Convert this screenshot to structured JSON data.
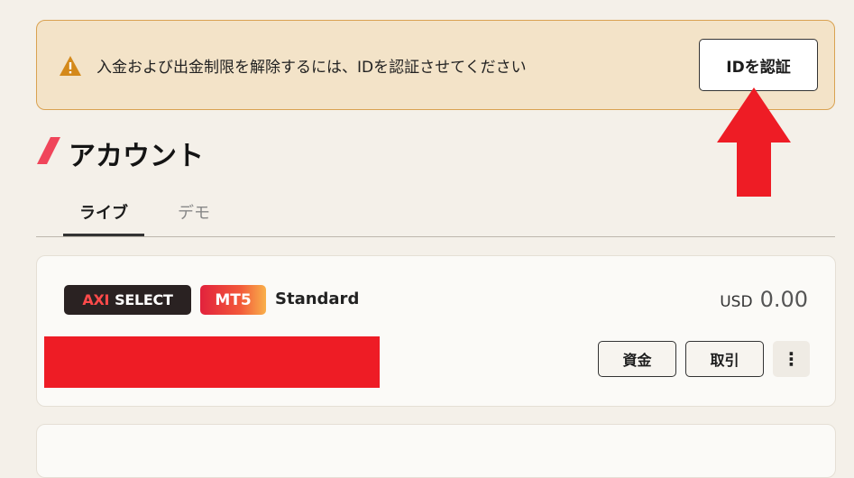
{
  "banner": {
    "message": "入金および出金制限を解除するには、IDを認証させてください",
    "button_label": "IDを認証",
    "icon": "warning-icon"
  },
  "section": {
    "title": "アカウント"
  },
  "tabs": [
    {
      "label": "ライブ",
      "active": true
    },
    {
      "label": "デモ",
      "active": false
    }
  ],
  "account_card": {
    "brand_badge_prefix": "AXI",
    "brand_badge_suffix": "SELECT",
    "platform_badge": "MT5",
    "account_type": "Standard",
    "currency": "USD",
    "balance": "0.00",
    "fund_button": "資金",
    "trade_button": "取引",
    "more_icon": "⋮"
  },
  "colors": {
    "banner_bg": "#f3e3c8",
    "banner_border": "#d9a251",
    "arrow": "#ee1c25",
    "redaction": "#ee1c25",
    "accent": "#e2223c"
  }
}
